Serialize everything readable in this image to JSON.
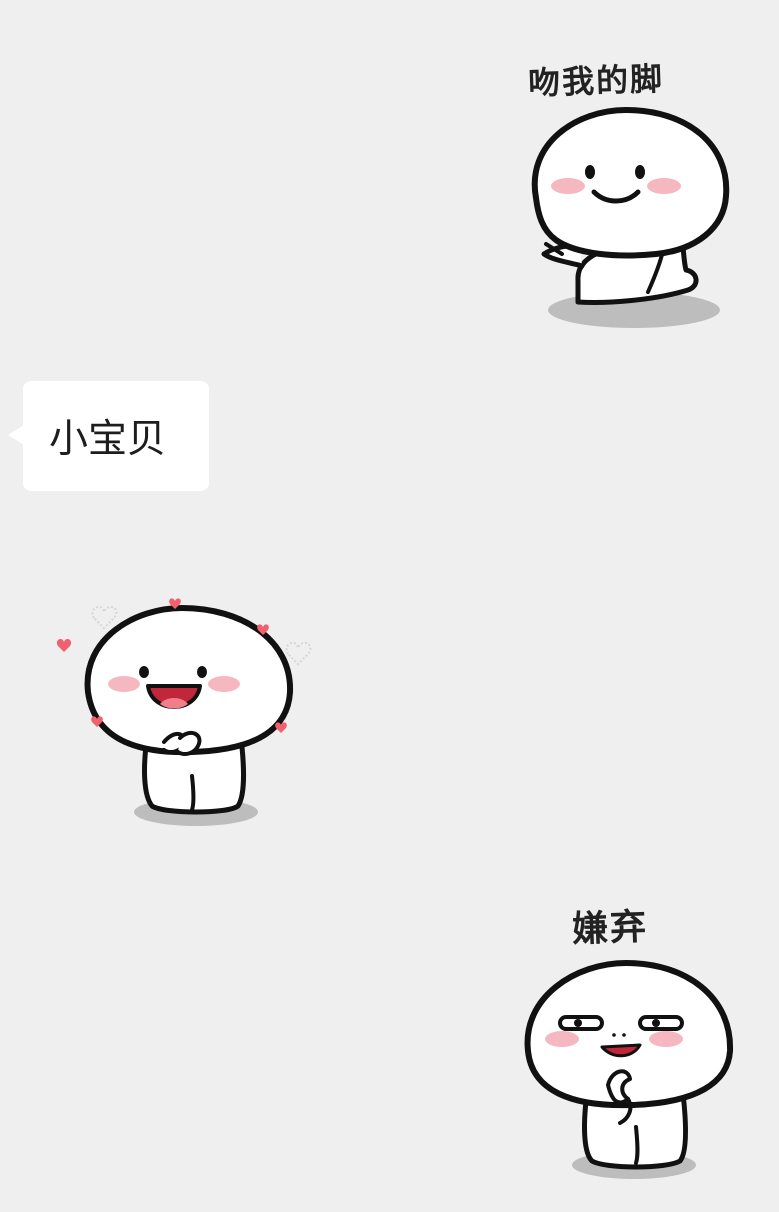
{
  "chat": {
    "messages": [
      {
        "type": "sticker",
        "side": "right",
        "caption": "吻我的脚",
        "icon": "kiss-my-feet-sticker-icon"
      },
      {
        "type": "text",
        "side": "left",
        "text": "小宝贝"
      },
      {
        "type": "sticker",
        "side": "left",
        "caption": "",
        "icon": "happy-hearts-sticker-icon"
      },
      {
        "type": "sticker",
        "side": "right",
        "caption": "嫌弃",
        "icon": "disgusted-sticker-icon"
      }
    ]
  },
  "colors": {
    "background": "#efefef",
    "bubble": "#ffffff",
    "text": "#1d1d1d",
    "blush": "#f6b8c0",
    "heart": "#f0606e",
    "shadow": "#bdbdbd"
  }
}
